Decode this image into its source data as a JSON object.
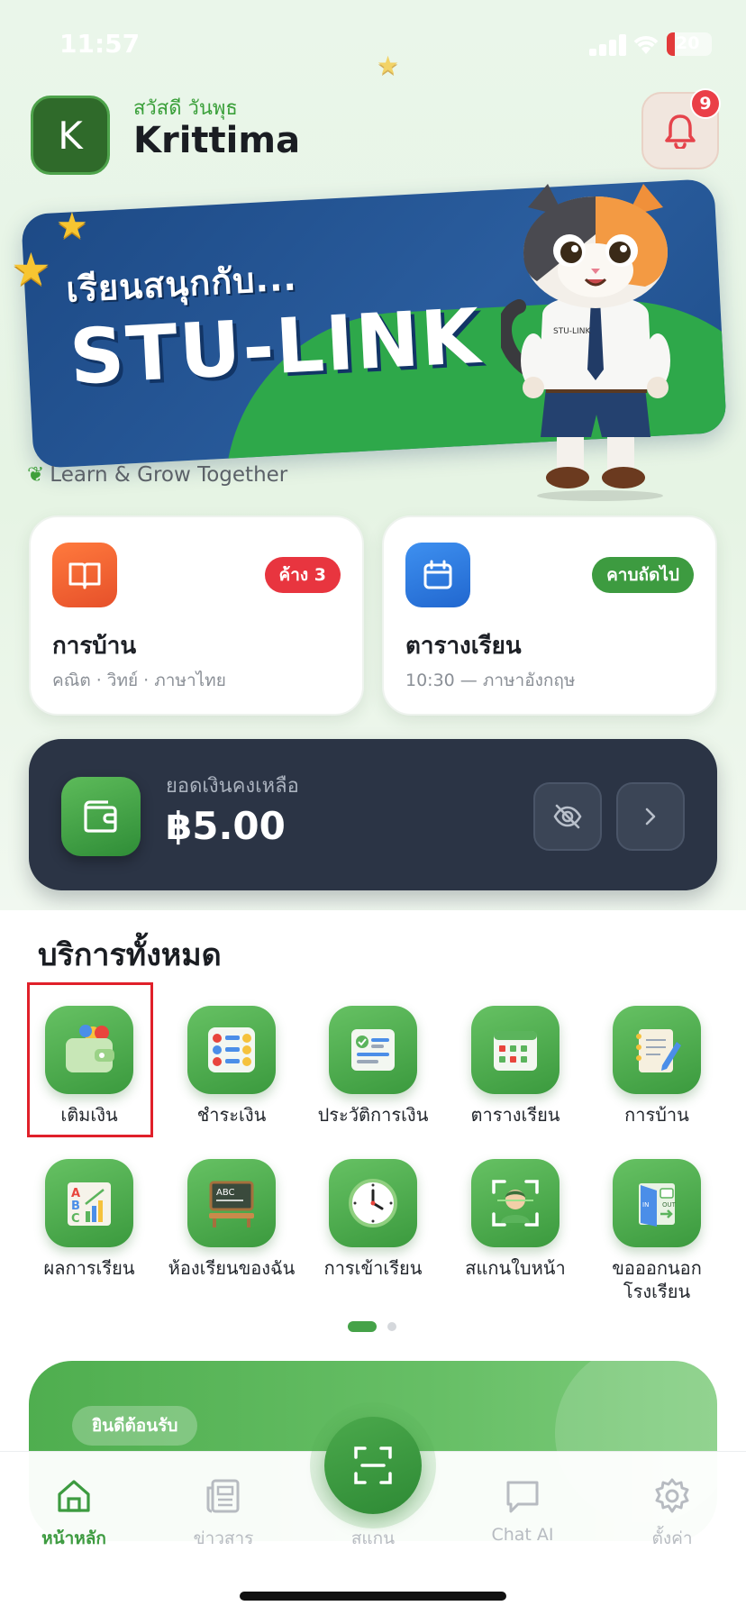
{
  "status_bar": {
    "time": "11:57",
    "battery": "20"
  },
  "header": {
    "avatar_letter": "K",
    "greeting": "สวัสดี วันพุธ",
    "user_name": "Krittima",
    "notification_count": "9"
  },
  "banner": {
    "subtitle": "เรียนสนุกกับ...",
    "title": "STU-LINK",
    "tagline": "Learn & Grow Together"
  },
  "cards": {
    "homework": {
      "title": "การบ้าน",
      "badge": "ค้าง 3",
      "subtitle": "คณิต · วิทย์ · ภาษาไทย",
      "accent": "#f06a2c"
    },
    "schedule": {
      "title": "ตารางเรียน",
      "badge": "คาบถัดไป",
      "subtitle": "10:30 — ภาษาอังกฤษ",
      "accent": "#2f7fe0"
    }
  },
  "balance": {
    "label": "ยอดเงินคงเหลือ",
    "amount": "฿5.00"
  },
  "services": {
    "title": "บริการทั้งหมด",
    "items": [
      {
        "label": "เติมเงิน",
        "icon": "wallet-icon"
      },
      {
        "label": "ชำระเงิน",
        "icon": "payment-list-icon"
      },
      {
        "label": "ประวัติการเงิน",
        "icon": "finance-history-icon"
      },
      {
        "label": "ตารางเรียน",
        "icon": "calendar-icon"
      },
      {
        "label": "การบ้าน",
        "icon": "notebook-icon"
      },
      {
        "label": "ผลการเรียน",
        "icon": "grades-chart-icon"
      },
      {
        "label": "ห้องเรียนของฉัน",
        "icon": "classroom-icon"
      },
      {
        "label": "การเข้าเรียน",
        "icon": "clock-icon"
      },
      {
        "label": "สแกนใบหน้า",
        "icon": "face-scan-icon"
      },
      {
        "label": "ขอออกนอกโรงเรียน",
        "icon": "exit-door-icon"
      }
    ]
  },
  "welcome": {
    "pill": "ยินดีต้อนรับ"
  },
  "tab_bar": {
    "home": "หน้าหลัก",
    "news": "ข่าวสาร",
    "scan": "สแกน",
    "chat": "Chat AI",
    "settings": "ตั้งค่า"
  },
  "colors": {
    "primary_green": "#3d9b40",
    "dark_card": "#2b3445",
    "danger": "#ea3f48"
  }
}
